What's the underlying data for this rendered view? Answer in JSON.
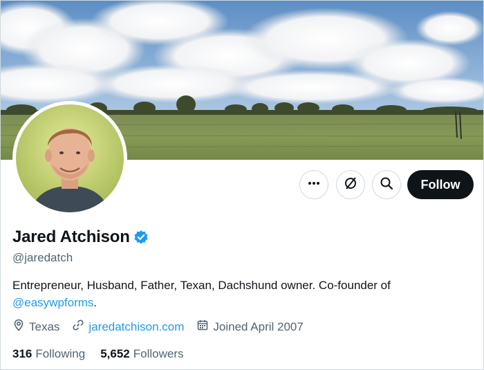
{
  "profile": {
    "display_name": "Jared Atchison",
    "handle": "@jaredatch",
    "bio_text": "Entrepreneur, Husband, Father, Texan, Dachshund owner. Co-founder of",
    "bio_mention": "@easywpforms",
    "bio_end": ".",
    "location": "Texas",
    "website": "jaredatchison.com",
    "joined": "Joined April 2007"
  },
  "stats": {
    "following_count": "316",
    "following_label": "Following",
    "followers_count": "5,652",
    "followers_label": "Followers"
  },
  "actions": {
    "follow_label": "Follow",
    "more_icon": "more-icon",
    "subscribe_icon": "notifications-off-icon",
    "search_icon": "search-icon"
  },
  "colors": {
    "accent": "#1d9bf0",
    "primary_text": "#0f1419",
    "secondary_text": "#536471",
    "follow_bg": "#0f1419"
  }
}
